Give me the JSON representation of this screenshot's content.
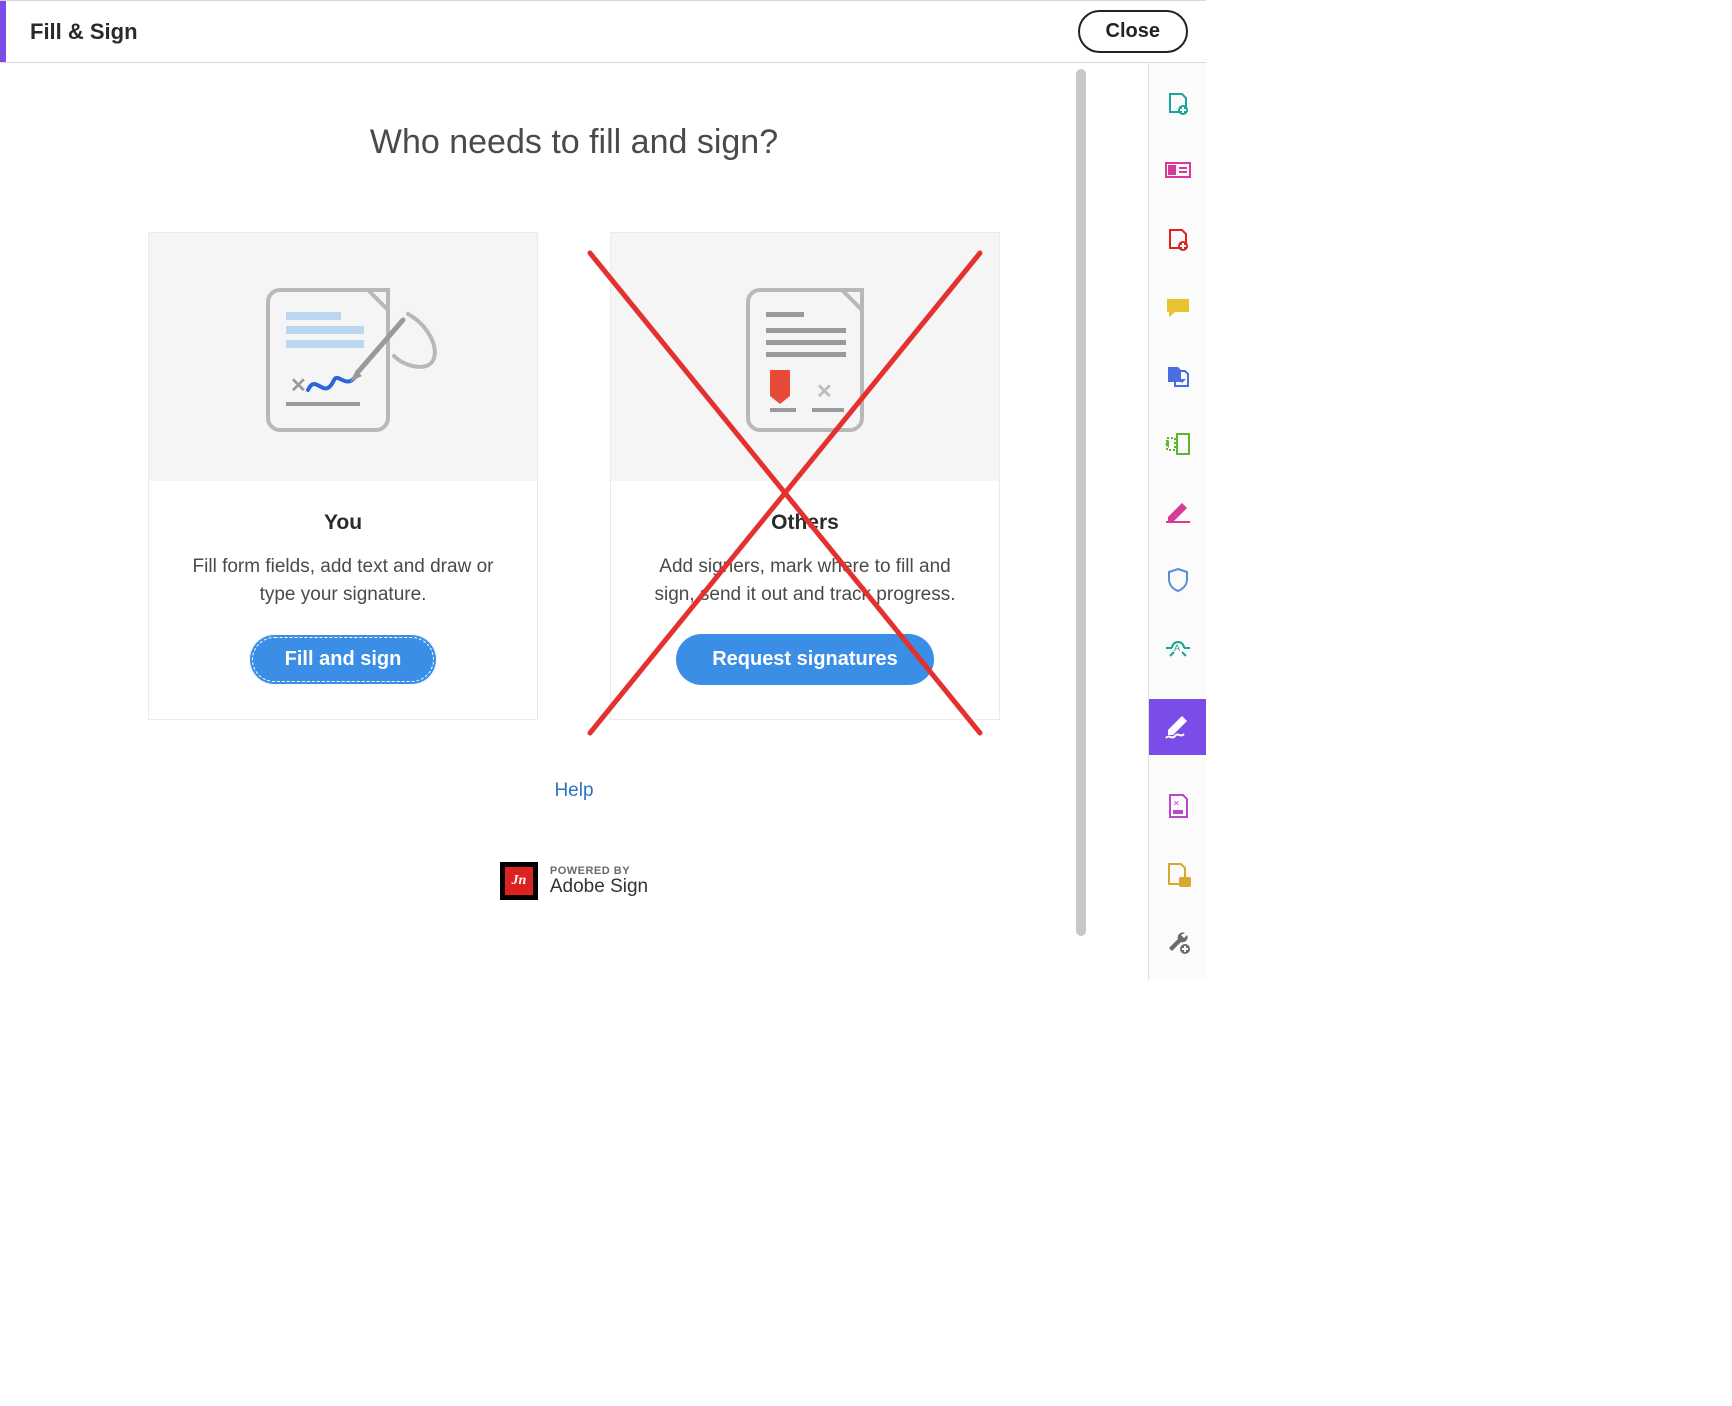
{
  "topbar": {
    "title": "Fill & Sign",
    "close_label": "Close"
  },
  "main": {
    "heading": "Who needs to fill and sign?",
    "help_label": "Help",
    "powered_small": "POWERED BY",
    "powered_big": "Adobe Sign"
  },
  "cards": {
    "you": {
      "title": "You",
      "desc": "Fill form fields, add text and draw or type your signature.",
      "button": "Fill and sign"
    },
    "others": {
      "title": "Others",
      "desc": "Add signers, mark where to fill and sign, send it out and track progress.",
      "button": "Request signatures"
    }
  },
  "rail": {
    "items": [
      "export-pdf-icon",
      "edit-text-icon",
      "create-pdf-icon",
      "comment-icon",
      "combine-files-icon",
      "organize-pages-icon",
      "fill-sign-icon",
      "protect-icon",
      "stamp-icon",
      "sign-active-icon",
      "redact-icon",
      "compare-icon",
      "more-tools-icon"
    ],
    "active_index": 9
  },
  "colors": {
    "accent": "#7a4de8",
    "primary_button": "#3a8ee6",
    "annotation_red": "#e53030"
  }
}
